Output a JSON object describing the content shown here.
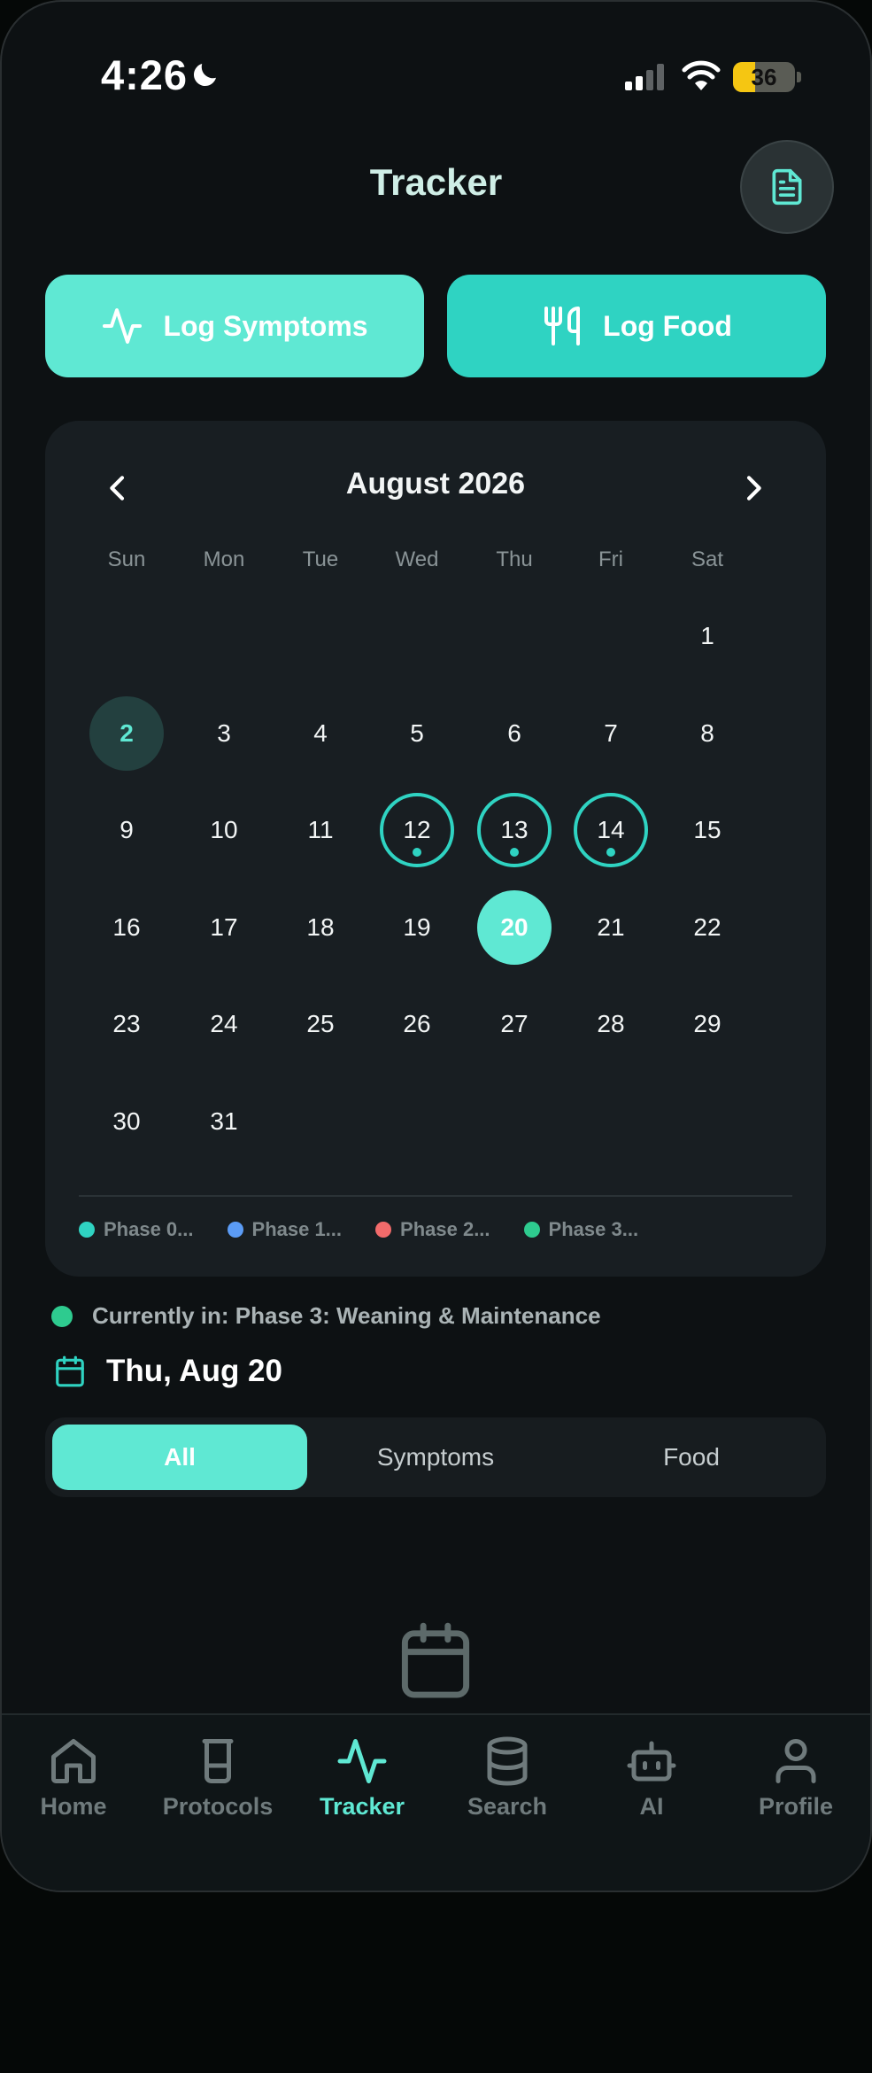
{
  "status": {
    "time": "4:26",
    "battery": "36",
    "battery_level": 0.36
  },
  "header": {
    "title": "Tracker",
    "report_icon": "document-icon"
  },
  "actions": {
    "log_symptoms": {
      "label": "Log Symptoms",
      "icon": "activity-icon"
    },
    "log_food": {
      "label": "Log Food",
      "icon": "utensils-icon"
    }
  },
  "calendar": {
    "month_label": "August 2026",
    "weekdays": [
      "Sun",
      "Mon",
      "Tue",
      "Wed",
      "Thu",
      "Fri",
      "Sat"
    ],
    "first_weekday": 6,
    "days_in_month": 31,
    "today": 2,
    "selected": 20,
    "logged_days": [
      12,
      13,
      14
    ]
  },
  "legend": [
    {
      "label": "Phase 0...",
      "color": "#2fd3c2"
    },
    {
      "label": "Phase 1...",
      "color": "#5b9cf6"
    },
    {
      "label": "Phase 2...",
      "color": "#f26b6b"
    },
    {
      "label": "Phase 3...",
      "color": "#2ecb8f"
    }
  ],
  "current_phase": {
    "text": "Currently in: Phase 3: Weaning & Maintenance",
    "color": "#2ecb8f"
  },
  "selected_date": "Thu, Aug 20",
  "filters": {
    "tabs": [
      "All",
      "Symptoms",
      "Food"
    ],
    "active": 0
  },
  "empty_state": {
    "icon": "calendar-icon"
  },
  "nav": {
    "items": [
      {
        "label": "Home",
        "icon": "home-icon"
      },
      {
        "label": "Protocols",
        "icon": "beaker-icon"
      },
      {
        "label": "Tracker",
        "icon": "activity-icon"
      },
      {
        "label": "Search",
        "icon": "database-icon"
      },
      {
        "label": "AI",
        "icon": "bot-icon"
      },
      {
        "label": "Profile",
        "icon": "user-icon"
      }
    ],
    "active": 2
  },
  "colors": {
    "accent": "#5fe8d3",
    "accent_dark": "#2fd3c2",
    "card": "#181e22",
    "background": "#0d1113"
  }
}
